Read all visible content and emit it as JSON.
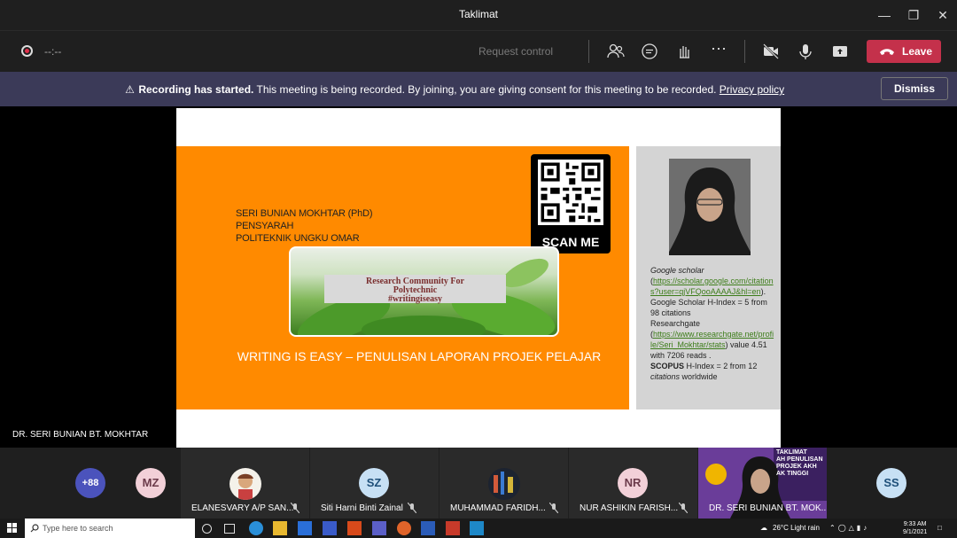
{
  "window": {
    "title": "Taklimat"
  },
  "toolbar": {
    "timer": "--:--",
    "request_control": "Request control",
    "leave_label": "Leave"
  },
  "banner": {
    "bold": "Recording has started.",
    "message": "This meeting is being recorded. By joining, you are giving consent for this meeting to be recorded.",
    "link": "Privacy policy",
    "dismiss": "Dismiss"
  },
  "slide": {
    "presenter_line1": "SERI BUNIAN MOKHTAR (PhD)",
    "presenter_line2": "PENSYARAH",
    "presenter_line3": "POLITEKNIK UNGKU OMAR",
    "qr_label": "SCAN ME",
    "caption_line1": "Research Community For",
    "caption_line2": "Polytechnic",
    "caption_line3": "#writingiseasy",
    "title": "WRITING IS EASY – PENULISAN LAPORAN PROJEK PELAJAR",
    "bio": {
      "gs_label": "Google scholar",
      "gs_link": "https://scholar.google.com/citations?user=qjVFQooAAAAJ&hl=en",
      "gs_text": "). Google Scholar H-Index = 5 from 98 citations",
      "rg_label": "Researchgate",
      "rg_link": "https://www.researchgate.net/profile/Seri_Mokhtar/stats",
      "rg_text": ") value 4.51 with 7206 reads .",
      "scopus_bold": "SCOPUS",
      "scopus_text": "H-Index = 2 from 12",
      "scopus_tail_italic": "citations",
      "scopus_tail": "worldwide"
    }
  },
  "speaker": {
    "name": "DR. SERI BUNIAN BT. MOKHTAR"
  },
  "participants": {
    "overflow": "+88",
    "mz": "MZ",
    "p1": "ELANESVARY A/P SAN...",
    "sz": "SZ",
    "p2": "Siti Harni Binti Zainal",
    "p3": "MUHAMMAD FARIDH...",
    "nr": "NR",
    "p4": "NUR ASHIKIN FARISH...",
    "p5": "DR. SERI BUNIAN BT. MOK...",
    "p5_overlay": "TAKLIMAT\nAH PENULISAN\nPROJEK AKH\nAK TINGGI",
    "ss": "SS"
  },
  "taskbar": {
    "search_placeholder": "Type here to search",
    "weather": "26°C  Light rain",
    "time": "9:33 AM",
    "date": "9/1/2021"
  },
  "colors": {
    "accent_leave": "#c4314b",
    "banner": "#3b3a58",
    "slide_orange": "#ff8a00"
  }
}
